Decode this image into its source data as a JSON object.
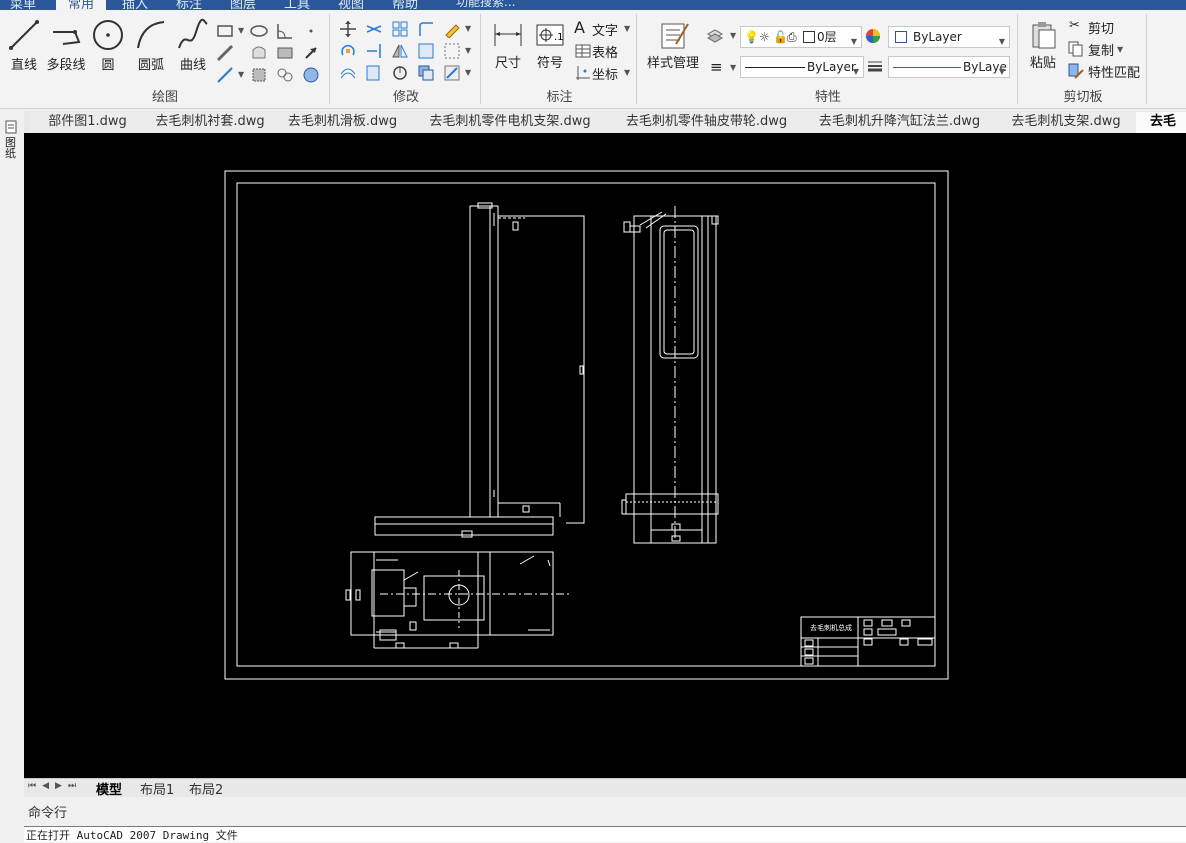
{
  "menu": {
    "items": [
      {
        "label": "菜单",
        "active": false
      },
      {
        "label": "常用",
        "active": true
      },
      {
        "label": "插入",
        "active": false
      },
      {
        "label": "标注",
        "active": false
      },
      {
        "label": "图层",
        "active": false
      },
      {
        "label": "工具",
        "active": false
      },
      {
        "label": "视图",
        "active": false
      },
      {
        "label": "帮助",
        "active": false
      }
    ],
    "search_placeholder": "功能搜索..."
  },
  "ribbon": {
    "draw": {
      "title": "绘图",
      "tools": [
        {
          "label": "直线",
          "icon": "line-icon"
        },
        {
          "label": "多段线",
          "icon": "polyline-icon"
        },
        {
          "label": "圆",
          "icon": "circle-icon"
        },
        {
          "label": "圆弧",
          "icon": "arc-icon"
        },
        {
          "label": "曲线",
          "icon": "spline-icon"
        }
      ]
    },
    "modify": {
      "title": "修改"
    },
    "annotate": {
      "title": "标注",
      "dimension_label": "尺寸",
      "symbol_label": "符号",
      "text_label": "文字",
      "table_label": "表格",
      "coord_label": "坐标"
    },
    "properties": {
      "title": "特性",
      "style_manager_label": "样式管理",
      "layer_value": "0层",
      "color_value": "ByLayer",
      "linetype_value": "ByLayer",
      "lineweight_value": "ByLaye"
    },
    "clipboard": {
      "title": "剪切板",
      "paste_label": "粘贴",
      "cut_label": "剪切",
      "copy_label": "复制",
      "matchprop_label": "特性匹配"
    }
  },
  "file_tabs": [
    {
      "label": "部件图1.dwg",
      "active": false
    },
    {
      "label": "去毛刺机衬套.dwg",
      "active": false
    },
    {
      "label": "去毛刺机滑板.dwg",
      "active": false
    },
    {
      "label": "去毛刺机零件电机支架.dwg",
      "active": false
    },
    {
      "label": "去毛刺机零件轴皮带轮.dwg",
      "active": false
    },
    {
      "label": "去毛刺机升降汽缸法兰.dwg",
      "active": false
    },
    {
      "label": "去毛刺机支架.dwg",
      "active": false
    },
    {
      "label": "去毛",
      "active": true
    }
  ],
  "left_strip": {
    "label": "图纸"
  },
  "drawing": {
    "title_block_text": "去毛刺机总成"
  },
  "layout_tabs": [
    {
      "label": "模型",
      "active": true
    },
    {
      "label": "布局1",
      "active": false
    },
    {
      "label": "布局2",
      "active": false
    }
  ],
  "command": {
    "label": "命令行",
    "history": "正在打开 AutoCAD 2007 Drawing 文件"
  }
}
